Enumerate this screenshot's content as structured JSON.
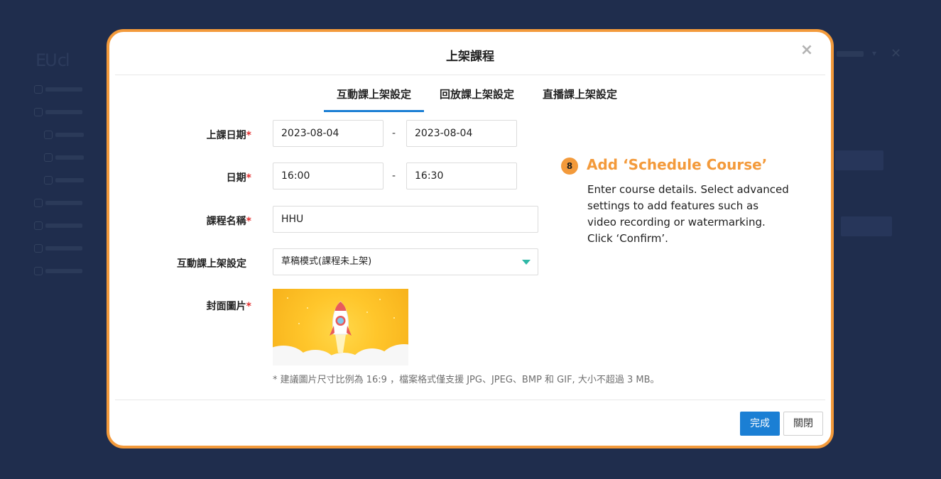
{
  "background": {
    "logo_text": "EU",
    "logo_suffix": "cl"
  },
  "modal": {
    "title": "上架課程",
    "close_glyph": "×",
    "tabs": [
      {
        "label": "互動課上架設定",
        "active": true
      },
      {
        "label": "回放課上架設定",
        "active": false
      },
      {
        "label": "直播課上架設定",
        "active": false
      }
    ],
    "form": {
      "class_date_label": "上課日期",
      "class_date_start": "2023-08-04",
      "class_date_end": "2023-08-04",
      "time_label": "日期",
      "time_start": "16:00",
      "time_end": "16:30",
      "course_name_label": "課程名稱",
      "course_name_value": "HHU",
      "setting_label": "互動課上架設定",
      "setting_value": "草稿模式(課程未上架)",
      "cover_label": "封面圖片",
      "range_separator": "-",
      "required_mark": "*",
      "cover_hint": "* 建議圖片尺寸比例為 16:9 ，檔案格式僅支援 JPG、JPEG、BMP 和 GIF, 大小不超過 3 MB。"
    },
    "buttons": {
      "confirm": "完成",
      "close": "關閉"
    }
  },
  "annotation": {
    "step": "8",
    "title": "Add ‘Schedule Course’",
    "lines": [
      "Enter course details. Select advanced",
      "settings to add features such as",
      "video recording or watermarking.",
      "Click ‘Confirm’."
    ]
  },
  "colors": {
    "background": "#1f2d4d",
    "modal_border": "#f39a3b",
    "accent_blue": "#1b7fd4",
    "required_red": "#e32f2f"
  }
}
